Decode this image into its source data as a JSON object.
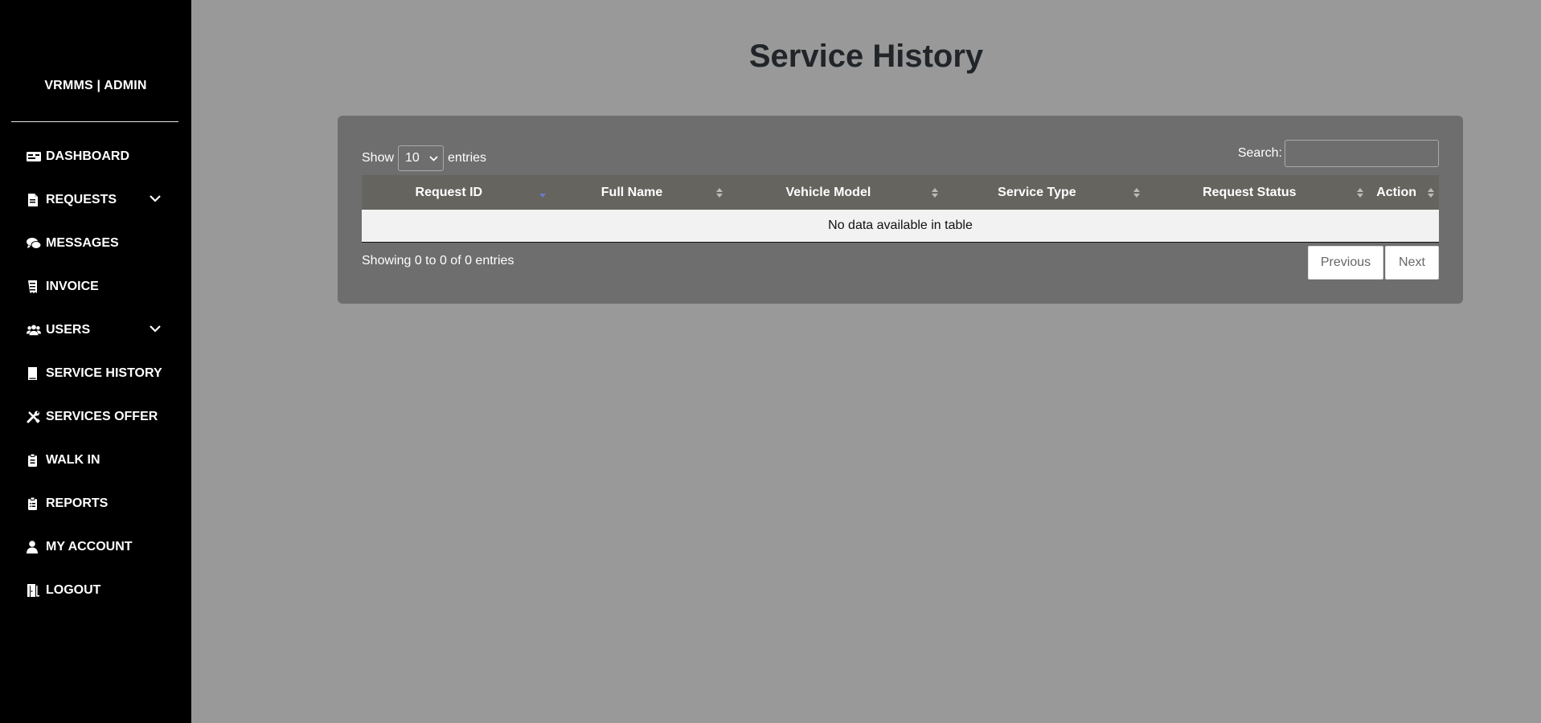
{
  "sidebar": {
    "brand": "VRMMS | ADMIN",
    "items": [
      {
        "label": "DASHBOARD",
        "icon": "dashboard-icon",
        "has_caret": false
      },
      {
        "label": "REQUESTS",
        "icon": "file-icon",
        "has_caret": true
      },
      {
        "label": "MESSAGES",
        "icon": "comments-icon",
        "has_caret": false
      },
      {
        "label": "INVOICE",
        "icon": "receipt-icon",
        "has_caret": false
      },
      {
        "label": "USERS",
        "icon": "users-icon",
        "has_caret": true
      },
      {
        "label": "SERVICE HISTORY",
        "icon": "book-icon",
        "has_caret": false
      },
      {
        "label": "SERVICES OFFER",
        "icon": "tools-icon",
        "has_caret": false
      },
      {
        "label": "WALK IN",
        "icon": "clipboard-icon",
        "has_caret": false
      },
      {
        "label": "REPORTS",
        "icon": "clipboard-list-icon",
        "has_caret": false
      },
      {
        "label": "MY ACCOUNT",
        "icon": "user-icon",
        "has_caret": false
      },
      {
        "label": "LOGOUT",
        "icon": "door-icon",
        "has_caret": false
      }
    ]
  },
  "page": {
    "title": "Service History"
  },
  "table_controls": {
    "show_label": "Show",
    "entries_label": "entries",
    "page_length": "10",
    "search_label": "Search:",
    "search_value": ""
  },
  "table": {
    "columns": [
      "Request ID",
      "Full Name",
      "Vehicle Model",
      "Service Type",
      "Request Status",
      "Action"
    ],
    "empty_message": "No data available in table",
    "info": "Showing 0 to 0 of 0 entries"
  },
  "pagination": {
    "previous": "Previous",
    "next": "Next"
  },
  "colors": {
    "sidebar_bg": "#000000",
    "page_bg": "#999999",
    "card_bg": "#6e6e6e",
    "header_bg": "#65645e",
    "sort_active": "#6d7cc4"
  }
}
